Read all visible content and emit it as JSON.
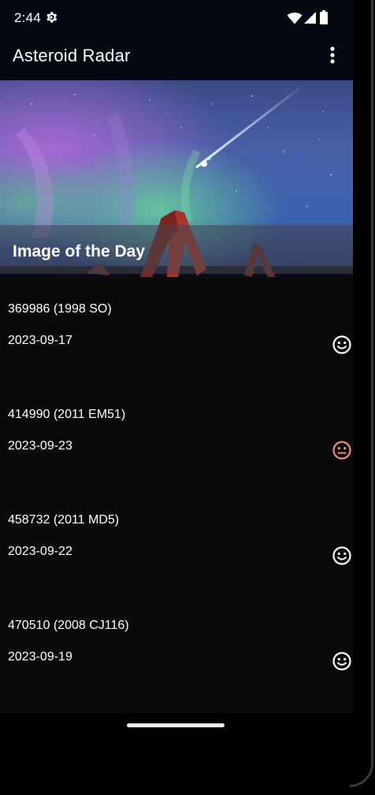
{
  "status_bar": {
    "time": "2:44",
    "icons": [
      "gear-icon",
      "wifi-icon",
      "signal-icon",
      "battery-icon"
    ]
  },
  "app_bar": {
    "title": "Asteroid Radar",
    "overflow_icon": "more-vert-icon"
  },
  "image_of_day": {
    "caption": "Image of the Day"
  },
  "asteroids": [
    {
      "name": "369986 (1998 SO)",
      "date": "2023-09-17",
      "status": "safe",
      "icon": "happy-face-icon",
      "icon_color": "#ffffff"
    },
    {
      "name": "414990 (2011 EM51)",
      "date": "2023-09-23",
      "status": "hazardous",
      "icon": "neutral-face-icon",
      "icon_color": "#f28b82"
    },
    {
      "name": "458732 (2011 MD5)",
      "date": "2023-09-22",
      "status": "safe",
      "icon": "happy-face-icon",
      "icon_color": "#ffffff"
    },
    {
      "name": "470510 (2008 CJ116)",
      "date": "2023-09-19",
      "status": "safe",
      "icon": "happy-face-icon",
      "icon_color": "#ffffff"
    }
  ],
  "colors": {
    "app_bar_bg": "#030712",
    "list_bg": "#0a0a0a",
    "text": "#ffffff",
    "hazard": "#f28b82"
  }
}
